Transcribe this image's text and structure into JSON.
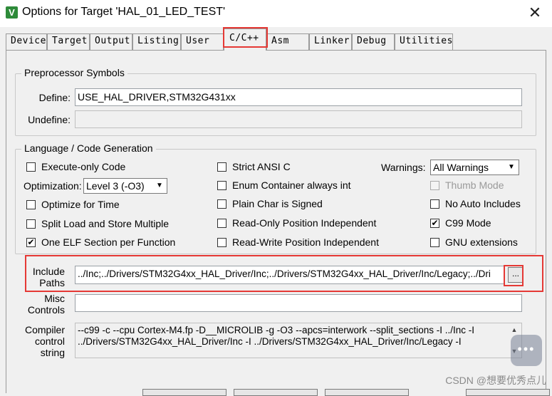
{
  "window": {
    "title": "Options for Target 'HAL_01_LED_TEST'",
    "close_glyph": "✕",
    "icon_letter": "V"
  },
  "tabs": [
    {
      "label": "Device"
    },
    {
      "label": "Target"
    },
    {
      "label": "Output"
    },
    {
      "label": "Listing"
    },
    {
      "label": "User"
    },
    {
      "label": "C/C++",
      "active": true
    },
    {
      "label": "Asm"
    },
    {
      "label": "Linker"
    },
    {
      "label": "Debug"
    },
    {
      "label": "Utilities"
    }
  ],
  "preprocessor": {
    "title": "Preprocessor Symbols",
    "define_label": "Define:",
    "define_value": "USE_HAL_DRIVER,STM32G431xx",
    "undefine_label": "Undefine:",
    "undefine_value": ""
  },
  "codegen": {
    "title": "Language / Code Generation",
    "execute_only": {
      "label": "Execute-only Code",
      "checked": false
    },
    "optimization_label": "Optimization:",
    "optimization_value": "Level 3 (-O3)",
    "optimize_time": {
      "label": "Optimize for Time",
      "checked": false
    },
    "split_load": {
      "label": "Split Load and Store Multiple",
      "checked": false
    },
    "one_elf": {
      "label": "One ELF Section per Function",
      "checked": true
    },
    "strict_ansi": {
      "label": "Strict ANSI C",
      "checked": false
    },
    "enum_container": {
      "label": "Enum Container always int",
      "checked": false
    },
    "plain_char": {
      "label": "Plain Char is Signed",
      "checked": false
    },
    "ro_pi": {
      "label": "Read-Only Position Independent",
      "checked": false
    },
    "rw_pi": {
      "label": "Read-Write Position Independent",
      "checked": false
    },
    "warnings_label": "Warnings:",
    "warnings_value": "All Warnings",
    "thumb_mode": {
      "label": "Thumb Mode",
      "checked": false,
      "disabled": true
    },
    "no_auto_includes": {
      "label": "No Auto Includes",
      "checked": false
    },
    "c99_mode": {
      "label": "C99 Mode",
      "checked": true
    },
    "gnu_ext": {
      "label": "GNU extensions",
      "checked": false
    }
  },
  "include": {
    "label_line1": "Include",
    "label_line2": "Paths",
    "value": "../Inc;../Drivers/STM32G4xx_HAL_Driver/Inc;../Drivers/STM32G4xx_HAL_Driver/Inc/Legacy;../Dri",
    "browse_label": "..."
  },
  "misc": {
    "label_line1": "Misc",
    "label_line2": "Controls",
    "value": ""
  },
  "compiler": {
    "label_line1": "Compiler",
    "label_line2": "control",
    "label_line3": "string",
    "line1": "--c99 -c --cpu Cortex-M4.fp -D__MICROLIB -g -O3 --apcs=interwork --split_sections -I ../Inc -I",
    "line2": "../Drivers/STM32G4xx_HAL_Driver/Inc -I ../Drivers/STM32G4xx_HAL_Driver/Inc/Legacy -I"
  },
  "icons": {
    "checkmark": "✔",
    "dropdown": "▼",
    "scroll_up": "▲",
    "scroll_down": "▼",
    "chat": "•••"
  },
  "watermark": "CSDN @想要优秀点儿",
  "colors": {
    "highlight": "#e53935",
    "app_icon": "#2e8b3a"
  }
}
